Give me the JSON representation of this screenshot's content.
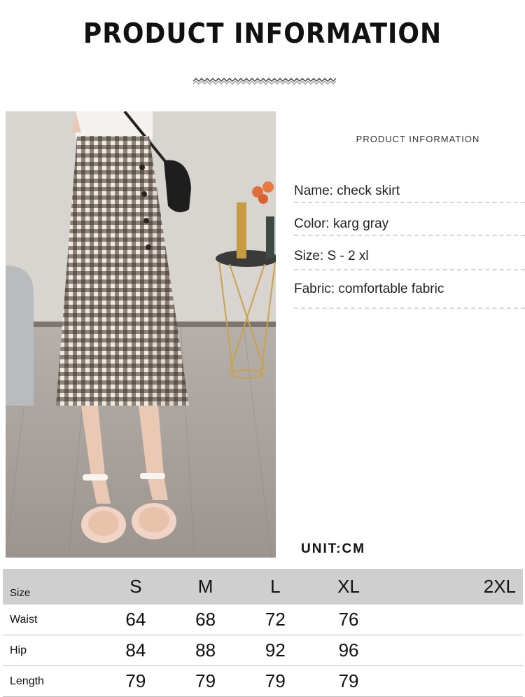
{
  "header": {
    "title": "PRODUCT INFORMATION"
  },
  "info": {
    "heading": "PRODUCT INFORMATION",
    "specs": [
      "Name: check skirt",
      "Color: karg gray",
      "Size: S - 2 xl",
      "Fabric: comfortable fabric"
    ]
  },
  "unit": "UNIT:CM",
  "size_table": {
    "header_label": "Size",
    "columns": [
      "S",
      "M",
      "L",
      "XL",
      "2XL"
    ],
    "rows": [
      {
        "label": "Waist",
        "values": [
          "64",
          "68",
          "72",
          "76",
          ""
        ]
      },
      {
        "label": "Hip",
        "values": [
          "84",
          "88",
          "92",
          "96",
          ""
        ]
      },
      {
        "label": "Length",
        "values": [
          "79",
          "79",
          "79",
          "79",
          ""
        ]
      }
    ]
  },
  "colors": {
    "table_header_bg": "#cfcfcf",
    "skirt_check": "#3a2f2a",
    "floor": "#a9a39d"
  },
  "image": {
    "subject": "model-wearing-check-skirt-photo"
  }
}
